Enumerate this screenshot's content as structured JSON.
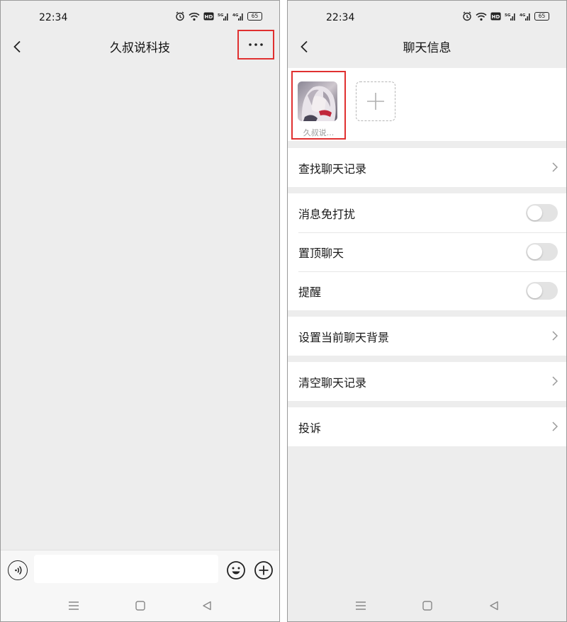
{
  "left_screen": {
    "status_bar": {
      "time": "22:34",
      "battery": "65"
    },
    "nav": {
      "title": "久叔说科技"
    },
    "input_bar": {
      "placeholder": ""
    }
  },
  "right_screen": {
    "status_bar": {
      "time": "22:34",
      "battery": "65"
    },
    "nav": {
      "title": "聊天信息"
    },
    "member": {
      "name": "久叔说..."
    },
    "rows": {
      "search_history": "查找聊天记录",
      "mute": "消息免打扰",
      "pin": "置顶聊天",
      "remind": "提醒",
      "background": "设置当前聊天背景",
      "clear_history": "清空聊天记录",
      "complain": "投诉"
    },
    "toggles": {
      "mute": false,
      "pin": false,
      "remind": false
    }
  },
  "colors": {
    "highlight_box": "#e03030",
    "page_bg": "#ededed",
    "toggle_off": "#e3e3e3"
  },
  "icons": [
    "back-arrow-icon",
    "more-dots-icon",
    "voice-icon",
    "emoji-icon",
    "plus-circle-icon",
    "menu-icon",
    "home-square-icon",
    "back-triangle-icon",
    "alarm-icon",
    "wifi-icon",
    "hd-icon",
    "signal-5g-icon",
    "signal-4g-icon",
    "battery-icon",
    "chevron-right-icon",
    "add-member-icon"
  ]
}
